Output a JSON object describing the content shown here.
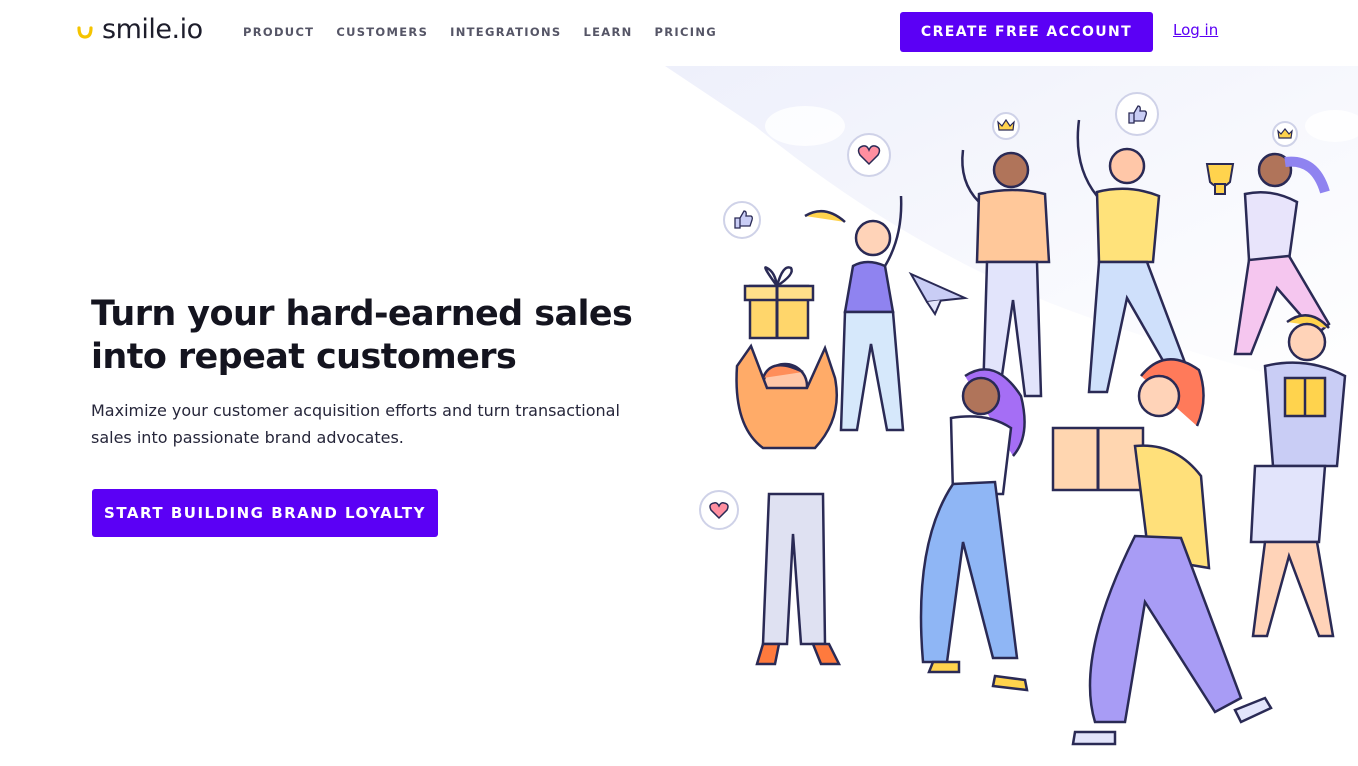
{
  "brand": {
    "name": "smile.io",
    "accent": "#5b00f5",
    "logo_mark_color": "#f5c400"
  },
  "nav": {
    "items": [
      {
        "label": "PRODUCT"
      },
      {
        "label": "CUSTOMERS"
      },
      {
        "label": "INTEGRATIONS"
      },
      {
        "label": "LEARN"
      },
      {
        "label": "PRICING"
      }
    ],
    "create_account_label": "CREATE FREE ACCOUNT",
    "login_label": "Log in"
  },
  "hero": {
    "title_line1": "Turn your hard-earned sales",
    "title_line2": "into repeat customers",
    "subtitle_line1": "Maximize your customer acquisition efforts and turn transactional",
    "subtitle_line2": "sales into passionate brand advocates.",
    "cta_label": "START BUILDING BRAND LOYALTY"
  },
  "illustration": {
    "icons": [
      "heart-icon",
      "thumbs-up-icon",
      "crown-icon",
      "trophy-icon",
      "paper-plane-icon",
      "gift-icon"
    ]
  }
}
